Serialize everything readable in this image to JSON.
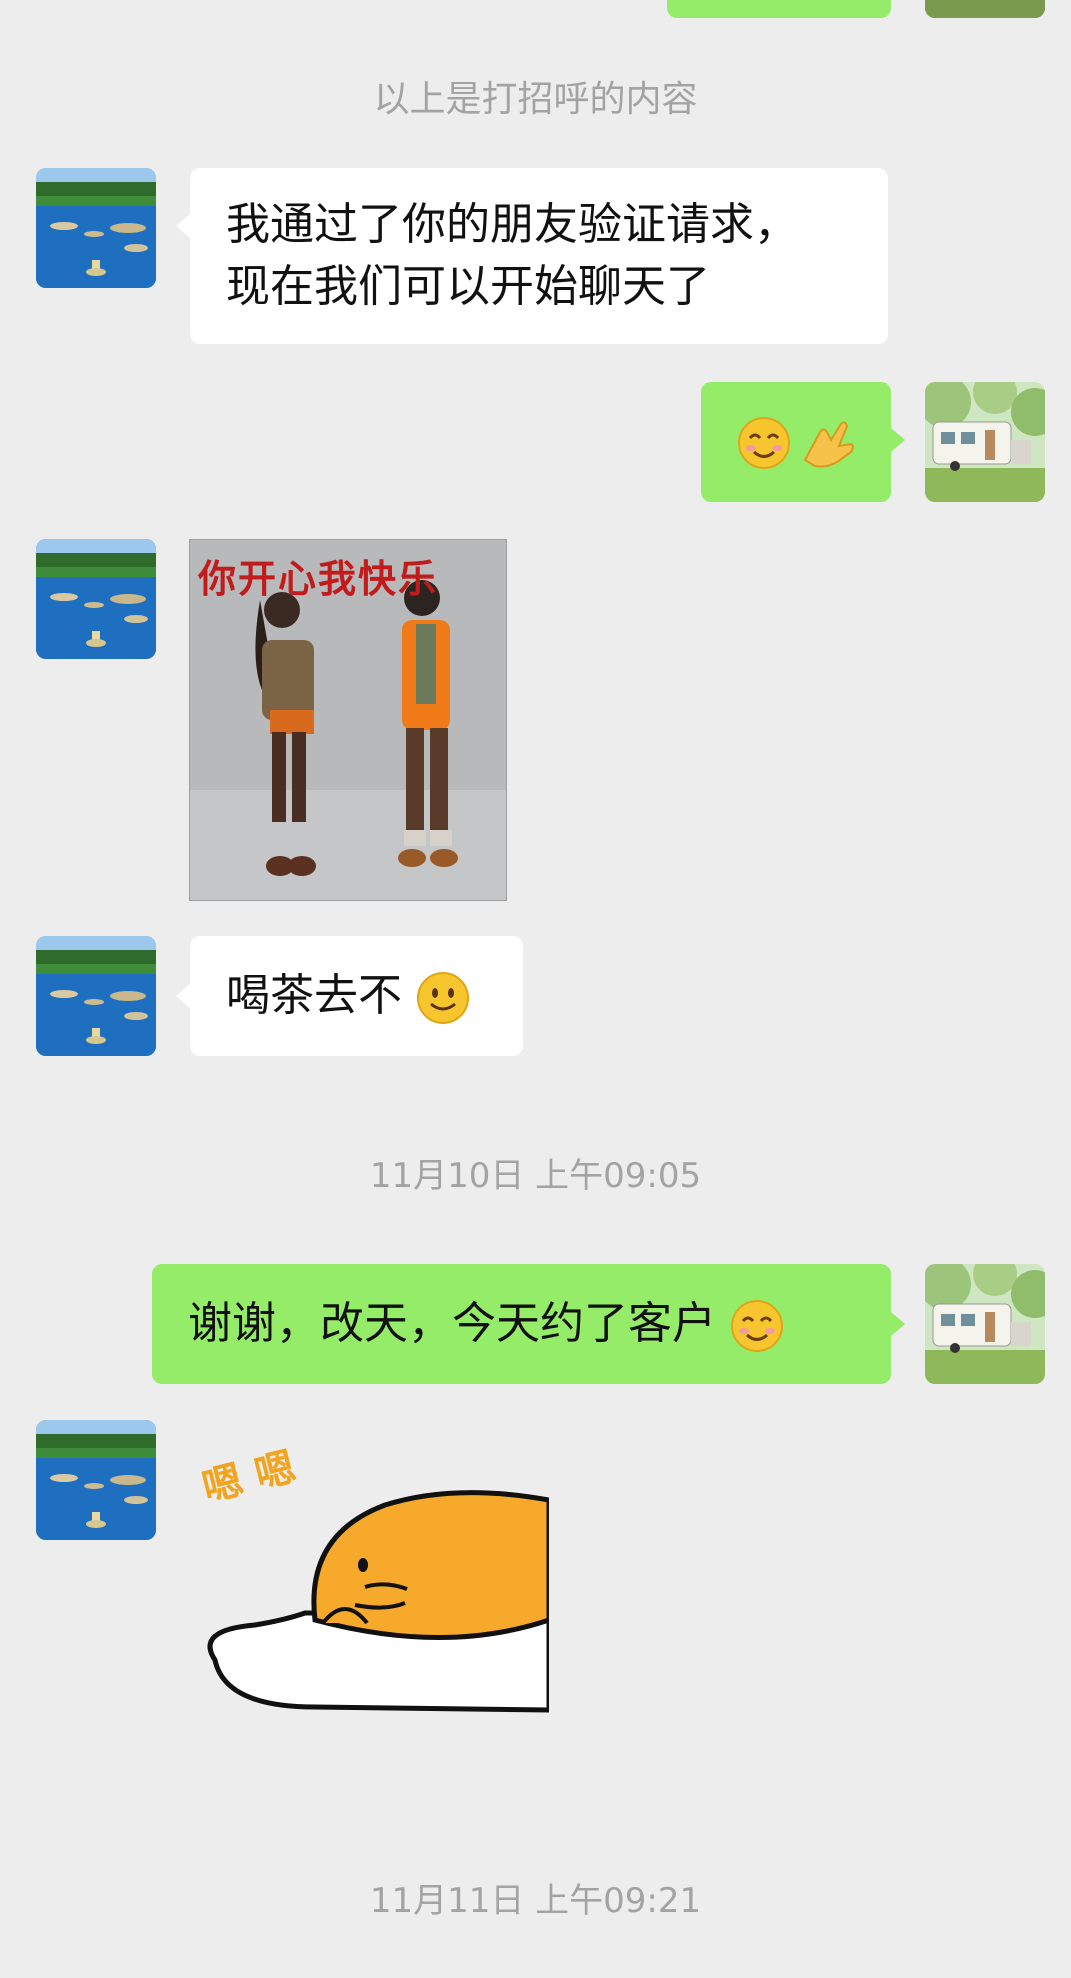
{
  "system_notice": "以上是打招呼的内容",
  "messages": [
    {
      "text_line1": "我通过了你的朋友验证请求，",
      "text_line2": "现在我们可以开始聊天了"
    },
    {
      "emoji": [
        "smiling-face-icon",
        "ok-hand-icon"
      ]
    },
    {
      "image_caption": "你开心我快乐"
    },
    {
      "text": "喝茶去不"
    },
    {
      "text": "谢谢，改天，今天约了客户"
    },
    {
      "sticker_text": "嗯 嗯"
    }
  ],
  "timestamps": [
    "11月10日 上午09:05",
    "11月11日 上午09:21"
  ],
  "colors": {
    "background": "#ededed",
    "sent_bubble": "#95ec69",
    "received_bubble": "#ffffff",
    "meta_text": "#a3a3a3"
  }
}
